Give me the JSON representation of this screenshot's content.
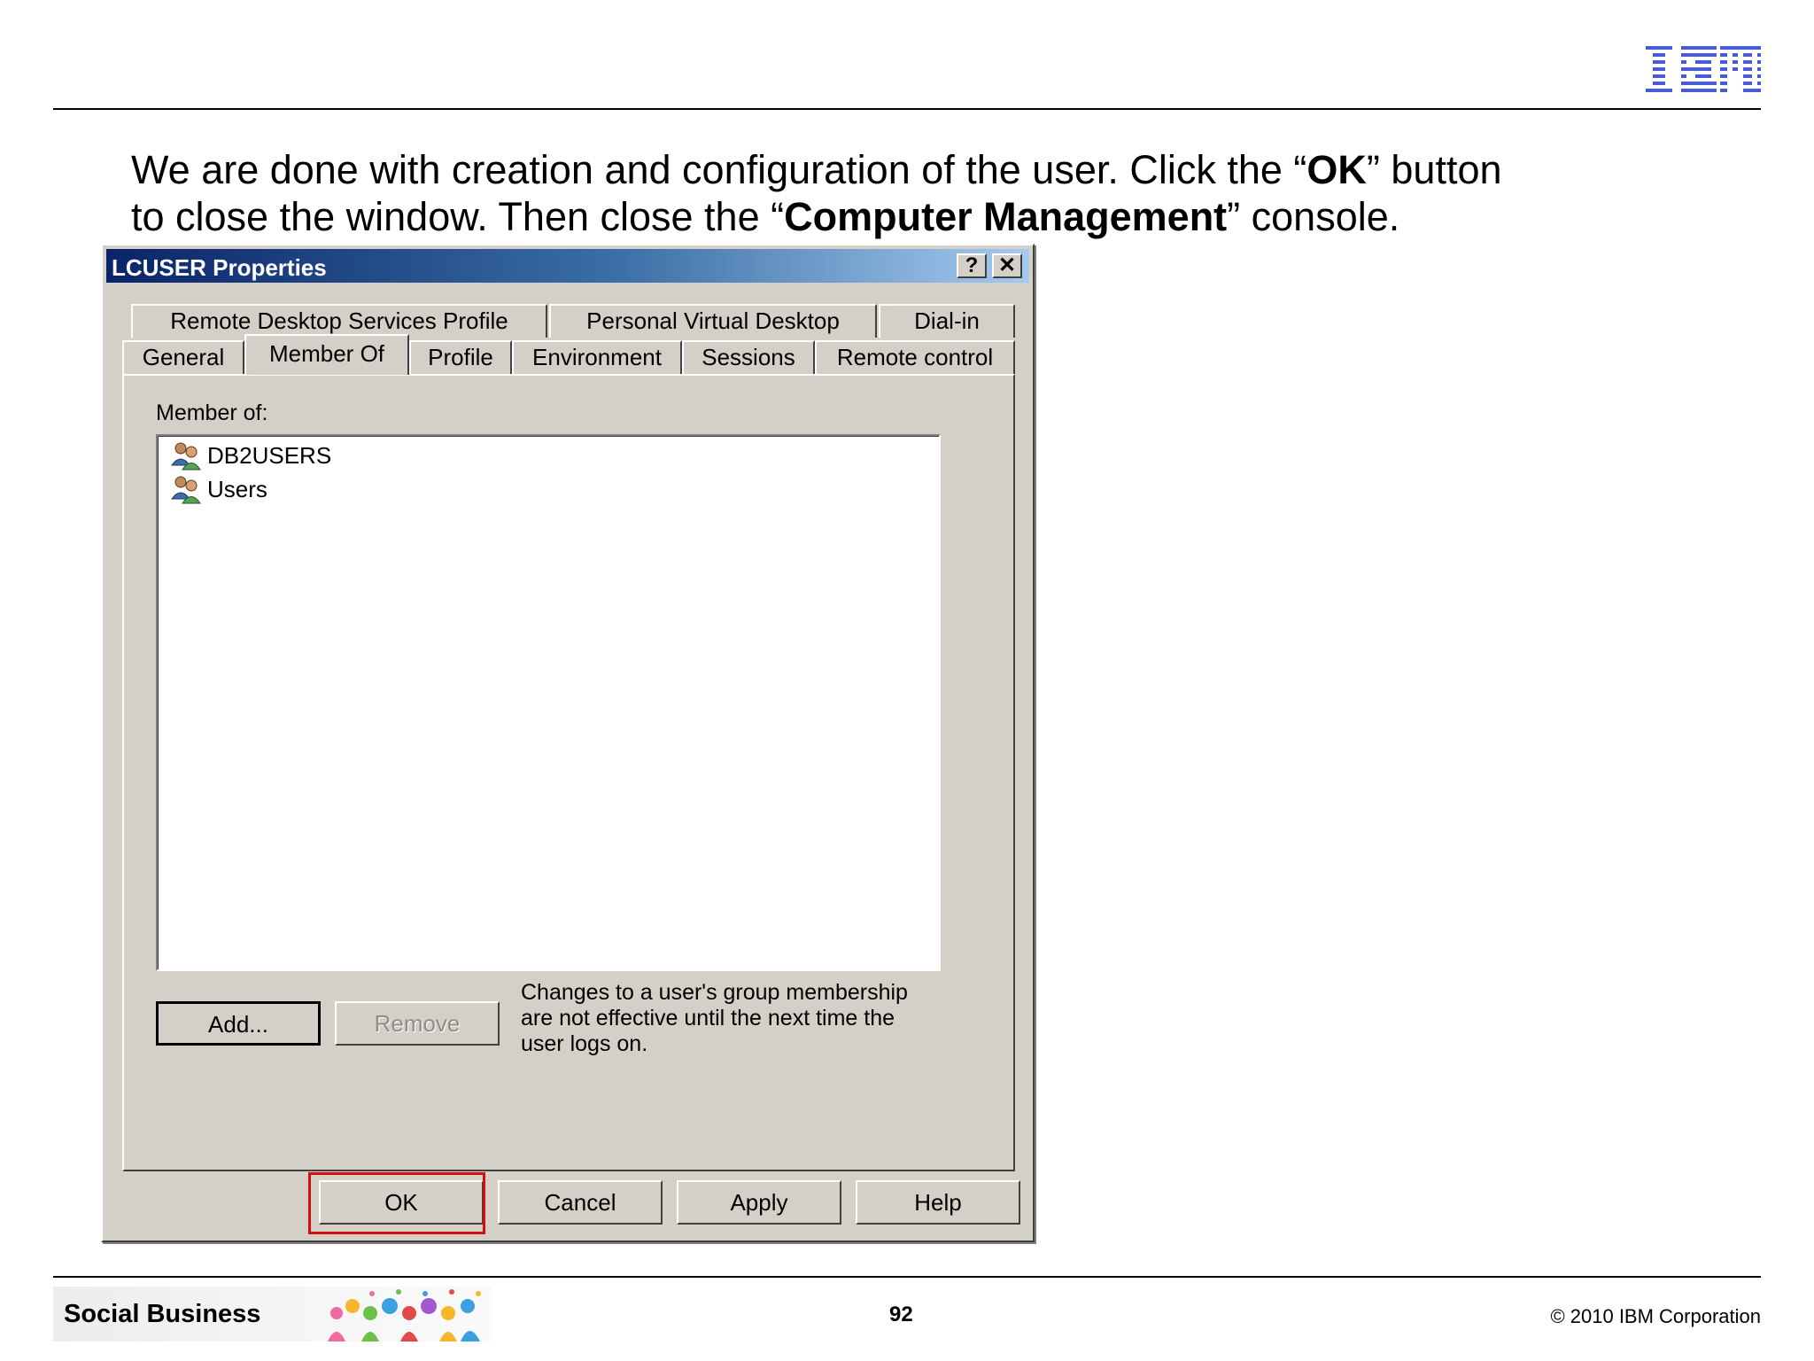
{
  "slide": {
    "logo_text": "IBM",
    "instruction": {
      "line1_a": "We are done with creation and configuration of the user. Click the “",
      "line1_bold": "OK",
      "line1_b": "” button",
      "line2_a": "to close the window. Then close the “",
      "line2_bold": "Computer Management",
      "line2_b": "” console."
    },
    "footer": {
      "banner_label": "Social Business",
      "page_number": "92",
      "copyright": "© 2010 IBM Corporation"
    }
  },
  "dialog": {
    "title": "LCUSER Properties",
    "help_glyph": "?",
    "close_glyph": "✕",
    "tabs_row1": [
      "Remote Desktop Services Profile",
      "Personal Virtual Desktop",
      "Dial-in"
    ],
    "tabs_row2": [
      "General",
      "Member Of",
      "Profile",
      "Environment",
      "Sessions",
      "Remote control"
    ],
    "active_tab": "Member Of",
    "member_of_label": "Member of:",
    "groups": [
      {
        "name": "DB2USERS",
        "icon": "group-icon"
      },
      {
        "name": "Users",
        "icon": "group-icon"
      }
    ],
    "add_label": "Add...",
    "remove_label": "Remove",
    "note": "Changes to a user's group membership are not effective until the next time the user logs on.",
    "ok_label": "OK",
    "cancel_label": "Cancel",
    "apply_label": "Apply",
    "help_label": "Help",
    "highlight_color": "#d01010",
    "titlebar_color": "#0a246a"
  }
}
